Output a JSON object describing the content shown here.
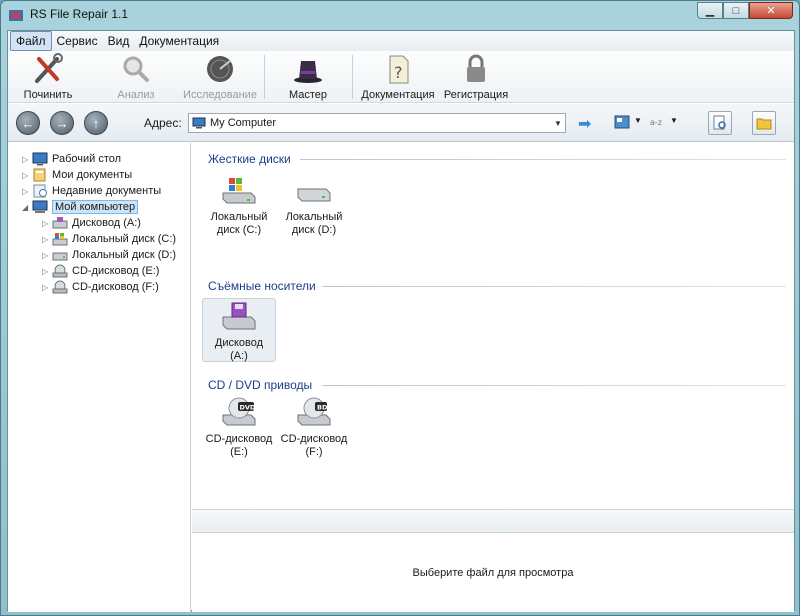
{
  "window": {
    "title": "RS File Repair 1.1"
  },
  "menu": [
    "Файл",
    "Сервис",
    "Вид",
    "Документация"
  ],
  "toolbar": {
    "repair": "Починить",
    "analysis": "Анализ",
    "research": "Исследование",
    "wizard": "Мастер",
    "docs": "Документация",
    "register": "Регистрация"
  },
  "address": {
    "label": "Адрес:",
    "value": "My Computer"
  },
  "tree": [
    {
      "label": "Рабочий стол"
    },
    {
      "label": "Мои документы"
    },
    {
      "label": "Недавние документы"
    },
    {
      "label": "Мой компьютер"
    },
    {
      "label": "Дисковод (A:)"
    },
    {
      "label": "Локальный диск (C:)"
    },
    {
      "label": "Локальный диск (D:)"
    },
    {
      "label": "CD-дисковод (E:)"
    },
    {
      "label": "CD-дисковод (F:)"
    }
  ],
  "groups": {
    "hdd": {
      "title": "Жесткие диски",
      "items": [
        {
          "line1": "Локальный",
          "line2": "диск (C:)"
        },
        {
          "line1": "Локальный",
          "line2": "диск (D:)"
        }
      ]
    },
    "removable": {
      "title": "Съёмные носители",
      "items": [
        {
          "line1": "Дисковод",
          "line2": "(A:)"
        }
      ]
    },
    "optical": {
      "title": "CD / DVD приводы",
      "items": [
        {
          "line1": "CD-дисковод",
          "line2": "(E:)",
          "badge": "DVD"
        },
        {
          "line1": "CD-дисковод",
          "line2": "(F:)",
          "badge": "BD"
        }
      ]
    }
  },
  "preview": {
    "text": "Выберите файл для просмотра"
  }
}
